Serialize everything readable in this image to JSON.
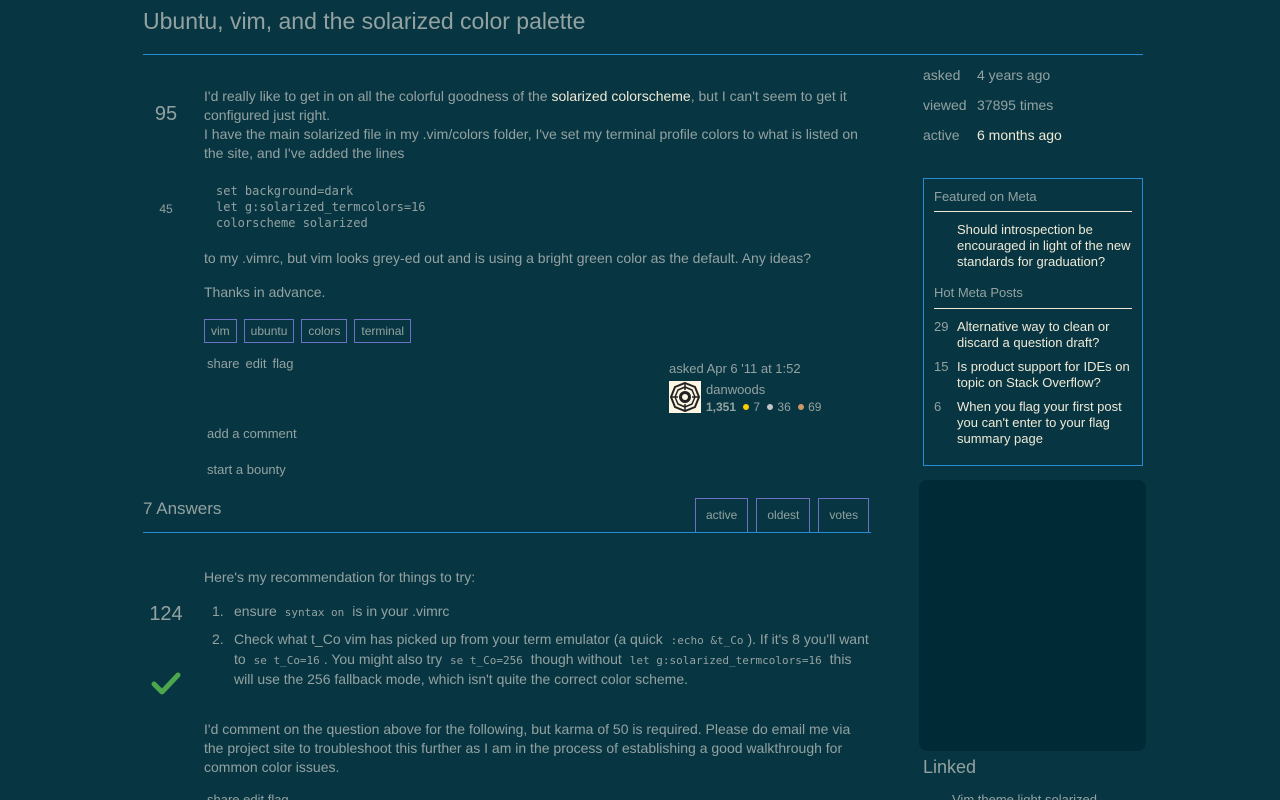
{
  "question": {
    "title": "Ubuntu, vim, and the solarized color palette",
    "votes": "95",
    "favorites": "45",
    "body_line1_pre": "I'd really like to get in on all the colorful goodness of the ",
    "body_link": "solarized colorscheme",
    "body_line1_post": ", but I can't seem to get it configured just right.",
    "body_line2": "I have the main solarized file in my .vim/colors folder, I've set my terminal profile colors to what is listed on the site, and I've added the lines",
    "code": "set background=dark\nlet g:solarized_termcolors=16\ncolorscheme solarized",
    "body_line3": "to my .vimrc, but vim looks grey-ed out and is using a bright green color as the default. Any ideas?",
    "body_line4": "Thanks in advance.",
    "tags": [
      "vim",
      "ubuntu",
      "colors",
      "terminal"
    ],
    "menu": [
      "share",
      "edit",
      "flag"
    ],
    "asked": "asked Apr 6 '11 at 1:52",
    "owner": {
      "name": "danwoods",
      "rep": "1,351",
      "gold": "7",
      "silver": "36",
      "bronze": "69"
    },
    "add_comment": "add a comment",
    "start_bounty": "start a bounty"
  },
  "answers": {
    "heading": "7 Answers",
    "sort_tabs": [
      "active",
      "oldest",
      "votes"
    ],
    "top": {
      "votes": "124",
      "intro": "Here's my recommendation for things to try:",
      "item1_num": "1.",
      "item1_pre": "ensure ",
      "item1_code": "syntax on",
      "item1_post": " is in your .vimrc",
      "item2_num": "2.",
      "item2_a": "Check what t_Co vim has picked up from your term emulator (a quick ",
      "item2_code1": ":echo &t_Co",
      "item2_b": "). If it's 8 you'll want to ",
      "item2_code2": "se t_Co=16",
      "item2_c": ". You might also try ",
      "item2_code3": "se t_Co=256",
      "item2_d": " though without ",
      "item2_code4": "let g:solarized_termcolors=16",
      "item2_e": " this will use the 256 fallback mode, which isn't quite the correct color scheme.",
      "closing": "I'd comment on the question above for the following, but karma of 50 is required. Please do email me via the project site to troubleshoot this further as I am in the process of establishing a good walkthrough for common color issues.",
      "menu": "share edit flag"
    }
  },
  "sidebar": {
    "stats": [
      {
        "label": "asked",
        "value": "4 years ago"
      },
      {
        "label": "viewed",
        "value": "37895 times"
      },
      {
        "label": "active",
        "value": "6 months ago"
      }
    ],
    "featured_heading": "Featured on Meta",
    "featured_item": "Should introspection be encouraged in light of the new standards for graduation?",
    "hot_heading": "Hot Meta Posts",
    "hot_items": [
      {
        "count": "29",
        "title": "Alternative way to clean or discard a question draft?"
      },
      {
        "count": "15",
        "title": "Is product support for IDEs on topic on Stack Overflow?"
      },
      {
        "count": "6",
        "title": "When you flag your first post you can't enter to your flag summary page"
      }
    ],
    "linked_heading": "Linked",
    "linked_item": "Vim theme light solarized"
  }
}
